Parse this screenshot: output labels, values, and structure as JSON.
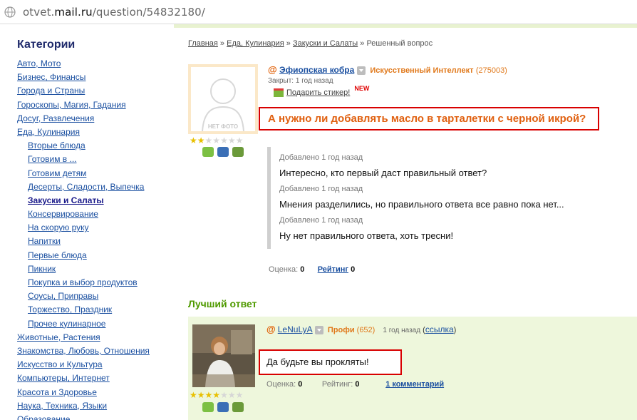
{
  "address_bar": {
    "host": "otvet.",
    "domain": "mail.ru",
    "path": "/question/54832180/"
  },
  "sidebar": {
    "title": "Категории",
    "items": [
      {
        "label": "Авто, Мото",
        "level": 0
      },
      {
        "label": "Бизнес, Финансы",
        "level": 0
      },
      {
        "label": "Города и Страны",
        "level": 0
      },
      {
        "label": "Гороскопы, Магия, Гадания",
        "level": 0
      },
      {
        "label": "Досуг, Развлечения",
        "level": 0
      },
      {
        "label": "Еда, Кулинария",
        "level": 0
      },
      {
        "label": "Вторые блюда",
        "level": 1
      },
      {
        "label": "Готовим в ...",
        "level": 1
      },
      {
        "label": "Готовим детям",
        "level": 1
      },
      {
        "label": "Десерты, Сладости, Выпечка",
        "level": 1
      },
      {
        "label": "Закуски и Салаты",
        "level": 1,
        "active": true
      },
      {
        "label": "Консервирование",
        "level": 1
      },
      {
        "label": "На скорую руку",
        "level": 1
      },
      {
        "label": "Напитки",
        "level": 1
      },
      {
        "label": "Первые блюда",
        "level": 1
      },
      {
        "label": "Пикник",
        "level": 1
      },
      {
        "label": "Покупка и выбор продуктов",
        "level": 1
      },
      {
        "label": "Соусы, Приправы",
        "level": 1
      },
      {
        "label": "Торжество, Праздник",
        "level": 1
      },
      {
        "label": "Прочее кулинарное",
        "level": 1
      },
      {
        "label": "Животные, Растения",
        "level": 0
      },
      {
        "label": "Знакомства, Любовь, Отношения",
        "level": 0
      },
      {
        "label": "Искусство и Культура",
        "level": 0
      },
      {
        "label": "Компьютеры, Интернет",
        "level": 0
      },
      {
        "label": "Красота и Здоровье",
        "level": 0
      },
      {
        "label": "Наука, Техника, Языки",
        "level": 0
      },
      {
        "label": "Образование",
        "level": 0
      }
    ]
  },
  "breadcrumb": {
    "items": [
      "Главная",
      "Еда, Кулинария",
      "Закуски и Салаты"
    ],
    "separator": " » ",
    "current": "Решенный вопрос"
  },
  "question": {
    "avatar_label": "НЕТ ФОТО",
    "stars": {
      "filled": 2,
      "total": 7
    },
    "at_sign": "@",
    "author": "Эфиопская кобра",
    "rank": "Искусственный Интеллект",
    "points": "(275003)",
    "closed": "Закрыт: 1 год назад",
    "gift_link": "Подарить стикер!",
    "new_badge": "NEW",
    "title": "А нужно ли добавлять масло в тарталетки с черной икрой?",
    "additions": [
      {
        "label": "Добавлено 1 год назад",
        "text": "Интересно, кто первый даст правильный ответ?"
      },
      {
        "label": "Добавлено 1 год назад",
        "text": "Мнения разделились, но правильного ответа все равно пока нет..."
      },
      {
        "label": "Добавлено 1 год назад",
        "text": "Ну нет правильного ответа, хоть тресни!"
      }
    ],
    "score_label": "Оценка:",
    "score_value": "0",
    "rating_label": "Рейтинг",
    "rating_value": "0"
  },
  "best_answer": {
    "heading": "Лучший ответ",
    "stars": {
      "filled": 4,
      "total": 7
    },
    "at_sign": "@",
    "author": "LeNuLyA",
    "rank": "Профи",
    "points": "(652)",
    "time": "1 год назад",
    "link_open": "(",
    "link": "ссылка",
    "link_close": ")",
    "text": "Да будьте вы прокляты!",
    "score_label": "Оценка:",
    "score_value": "0",
    "rating_label": "Рейтинг:",
    "rating_value": "0",
    "comments": "1 комментарий"
  },
  "colors": {
    "accent_orange": "#e06010",
    "link_blue": "#1a4fa0",
    "highlight_red": "#d80000",
    "best_green": "#4f9a00",
    "answer_bg": "#eef7dc"
  }
}
